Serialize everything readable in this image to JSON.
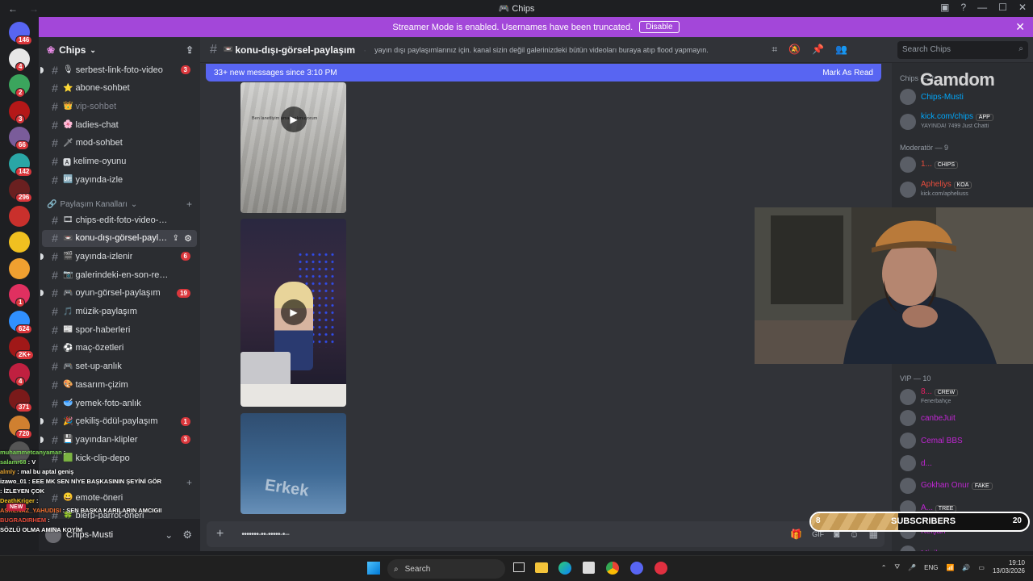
{
  "window": {
    "title": "Chips"
  },
  "banner": {
    "text": "Streamer Mode is enabled. Usernames have been truncated.",
    "button": "Disable"
  },
  "servers": [
    {
      "badge": "146",
      "color": "#5865f2"
    },
    {
      "badge": "4",
      "color": "#e7e7e7"
    },
    {
      "badge": "2",
      "color": "#3ba55d"
    },
    {
      "badge": "3",
      "color": "#b41818"
    },
    {
      "badge": "66",
      "color": "#7a5c9a"
    },
    {
      "badge": "142",
      "color": "#2aa6a6"
    },
    {
      "badge": "296",
      "color": "#6a2020"
    },
    {
      "badge": "",
      "color": "#c9302c"
    },
    {
      "badge": "",
      "color": "#f0c020"
    },
    {
      "badge": "",
      "color": "#f0a030"
    },
    {
      "badge": "1",
      "color": "#e03060"
    },
    {
      "badge": "624",
      "color": "#3090ff"
    },
    {
      "badge": "2K+",
      "color": "#a01818"
    },
    {
      "badge": "4",
      "color": "#c02040"
    },
    {
      "badge": "371",
      "color": "#7a1a1a"
    },
    {
      "badge": "720",
      "color": "#d08030"
    },
    {
      "badge": "",
      "color": "#555"
    }
  ],
  "guild": {
    "name": "Chips"
  },
  "channels_top": [
    {
      "emoji": "🎙",
      "name": "serbest-link-foto-video",
      "badge": "3"
    },
    {
      "emoji": "⭐",
      "name": "abone-sohbet",
      "badge": ""
    },
    {
      "emoji": "👑",
      "name": "vip-sohbet",
      "badge": "",
      "muted": true
    },
    {
      "emoji": "🌸",
      "name": "ladies-chat",
      "badge": ""
    },
    {
      "emoji": "🗡",
      "name": "mod-sohbet",
      "badge": ""
    },
    {
      "emoji": "🅰",
      "name": "kelime-oyunu",
      "badge": ""
    },
    {
      "emoji": "🆙",
      "name": "yayında-izle",
      "badge": ""
    }
  ],
  "category": {
    "name": "Paylaşım Kanalları"
  },
  "channels": [
    {
      "emoji": "🎞",
      "name": "chips-edit-foto-video-paylaş…",
      "badge": ""
    },
    {
      "emoji": "📼",
      "name": "konu-dışı-görsel-payla…",
      "badge": "",
      "active": true
    },
    {
      "emoji": "🎬",
      "name": "yayında-izlenir",
      "badge": "6"
    },
    {
      "emoji": "📷",
      "name": "galerindeki-en-son-resim",
      "badge": ""
    },
    {
      "emoji": "🎮",
      "name": "oyun-görsel-paylaşım",
      "badge": "19"
    },
    {
      "emoji": "🎵",
      "name": "müzik-paylaşım",
      "badge": ""
    },
    {
      "emoji": "📰",
      "name": "spor-haberleri",
      "badge": ""
    },
    {
      "emoji": "⚽",
      "name": "maç-özetleri",
      "badge": ""
    },
    {
      "emoji": "🎮",
      "name": "set-up-anlık",
      "badge": ""
    },
    {
      "emoji": "🎨",
      "name": "tasarım-çizim",
      "badge": ""
    },
    {
      "emoji": "🥣",
      "name": "yemek-foto-anlık",
      "badge": ""
    },
    {
      "emoji": "🎉",
      "name": "çekiliş-ödül-paylaşım",
      "badge": "1"
    },
    {
      "emoji": "💾",
      "name": "yayından-klipler",
      "badge": "3"
    },
    {
      "emoji": "🟩",
      "name": "kick-clip-depo",
      "badge": ""
    }
  ],
  "channels_bottom": [
    {
      "emoji": "😀",
      "name": "emote-öneri",
      "badge": ""
    },
    {
      "emoji": "🍀",
      "name": "blerp-parrot-öneri",
      "badge": ""
    }
  ],
  "user": {
    "name": "Chips-Musti"
  },
  "channel_header": {
    "name": "konu-dışı-görsel-paylaşım",
    "topic": "yayın dışı paylaşımlarınız için. kanal sizin değil galerinizdeki bütün videoları buraya atıp flood yapmayın.",
    "search_placeholder": "Search Chips"
  },
  "new_messages": {
    "text": "33+ new messages since 3:10 PM",
    "action": "Mark As Read"
  },
  "videos": [
    {
      "caption": "Ben lanetliyim ama korkmuyorum"
    },
    {
      "caption": ""
    },
    {
      "caption": "Erkek"
    }
  ],
  "composer": {
    "text": "•••••••-••-•••••-•--"
  },
  "members": {
    "owner_group": "Chips — 2",
    "owner": [
      {
        "name": "Chips-Musti",
        "status": "",
        "color": "#00a8fc"
      },
      {
        "name": "kick.com/chips",
        "status": "YAYINDA! 7499 Just Chatti",
        "tag": "APP",
        "color": "#00a8fc"
      }
    ],
    "mod_group": "Moderatör — 9",
    "mods": [
      {
        "name": "1...",
        "tag": "CHIPS",
        "color": "#e74c3c"
      },
      {
        "name": "Apheliys",
        "tag": "KOA",
        "status": "kick.com/apheliuss",
        "color": "#e74c3c"
      }
    ],
    "vip_group": "VIP — 10",
    "vips": [
      {
        "name": "8...",
        "tag": "CREW",
        "status": "Fenerbahçe",
        "color": "#e91e63"
      },
      {
        "name": "canbeJuit",
        "color": "#c026d3"
      },
      {
        "name": "Cemal BBS",
        "color": "#c026d3"
      },
      {
        "name": "d...",
        "color": "#c026d3"
      },
      {
        "name": "Gokhan Onur",
        "tag": "FAKE",
        "color": "#c026d3"
      },
      {
        "name": "A...",
        "tag": "TREE",
        "color": "#c026d3"
      },
      {
        "name": "Keişan",
        "color": "#c026d3"
      },
      {
        "name": "Minik",
        "color": "#c026d3"
      }
    ]
  },
  "overlay": {
    "brand": "Gamdom",
    "chat": [
      {
        "user": "muhammetcanyaman",
        "msg": ":",
        "color": "#7ed957"
      },
      {
        "user": "salamr68",
        "msg": ": V",
        "color": "#7ed957"
      },
      {
        "user": "almly",
        "msg": ": mal bu aptal geniş",
        "color": "#e0a030"
      },
      {
        "user": "izawo_01",
        "msg": ": EEE MK SEN NİYE BAŞKASININ ŞEYİNİ GÖRÜYON",
        "color": "#fff"
      },
      {
        "user": "",
        "msg": ": İZLEYEN ÇOK",
        "color": "#fff"
      },
      {
        "user": "DeathKriger",
        "msg": ":",
        "color": "#f0c020"
      },
      {
        "user": "ASKENAZ_YAHUDISI",
        "msg": ": SEN BAŞKA KARILARIN AMCIGINI GORUYON* *7?",
        "color": "#f07030"
      },
      {
        "user": "BUGRADIRHEM",
        "msg": ":",
        "color": "#e74c3c"
      },
      {
        "user": "",
        "msg": "SÖZLÜ OLMA AMINA KOYİM",
        "color": "#fff"
      }
    ],
    "new_badge": "NEW",
    "subs": {
      "label": "SUBSCRIBERS",
      "current": "8",
      "goal": "20",
      "progress": 0.4
    }
  },
  "taskbar": {
    "search": "Search",
    "lang": "ENG",
    "time": "19:10",
    "date": "13/03/2026"
  }
}
